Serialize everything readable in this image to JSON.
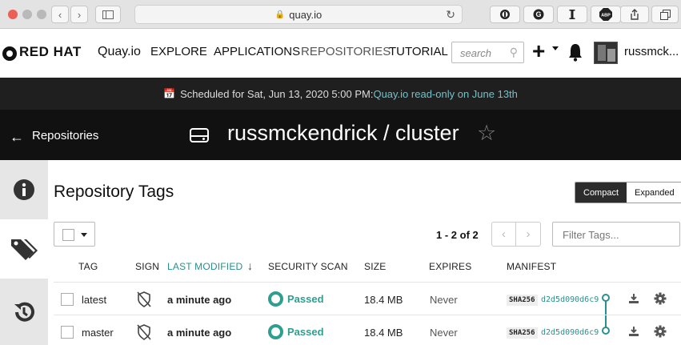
{
  "browser": {
    "url": "quay.io",
    "back_glyph": "‹",
    "forward_glyph": "›",
    "colors": {
      "close": "#ec5f57",
      "minimize": "#b9b9b9",
      "maximize": "#b9b9b9"
    }
  },
  "header": {
    "brand": "RED HAT",
    "product": "Quay.io",
    "nav": [
      "EXPLORE",
      "APPLICATIONS",
      "REPOSITORIES",
      "TUTORIAL"
    ],
    "search_placeholder": "search",
    "username": "russmck..."
  },
  "banner": {
    "prefix": "Scheduled for Sat, Jun 13, 2020 5:00 PM:",
    "highlight": "Quay.io read-only on June 13th"
  },
  "repo_bar": {
    "back_label": "Repositories",
    "title": "russmckendrick / cluster"
  },
  "main": {
    "title": "Repository Tags",
    "view_toggle": {
      "compact": "Compact",
      "expanded": "Expanded",
      "selected": "Compact"
    },
    "page_count": "1 - 2 of 2",
    "filter_placeholder": "Filter Tags...",
    "columns": {
      "tag": "TAG",
      "sign": "SIGN",
      "last_modified": "LAST MODIFIED",
      "security_scan": "SECURITY SCAN",
      "size": "SIZE",
      "expires": "EXPIRES",
      "manifest": "MANIFEST"
    },
    "rows": [
      {
        "tag": "latest",
        "last_modified": "a minute ago",
        "scan": "Passed",
        "size": "18.4 MB",
        "expires": "Never",
        "sha_label": "SHA256",
        "digest": "d2d5d090d6c9"
      },
      {
        "tag": "master",
        "last_modified": "a minute ago",
        "scan": "Passed",
        "size": "18.4 MB",
        "expires": "Never",
        "sha_label": "SHA256",
        "digest": "d2d5d090d6c9"
      }
    ]
  },
  "icons": {
    "info": "info-icon",
    "tags": "tags-icon",
    "history": "history-icon",
    "download": "download-icon",
    "gear": "gear-icon",
    "unsigned_shield": "shield-off-icon"
  },
  "colors": {
    "accent": "#2a8f8d",
    "banner_link": "#6fc3c8",
    "scan_pass": "#2e9f8f"
  }
}
